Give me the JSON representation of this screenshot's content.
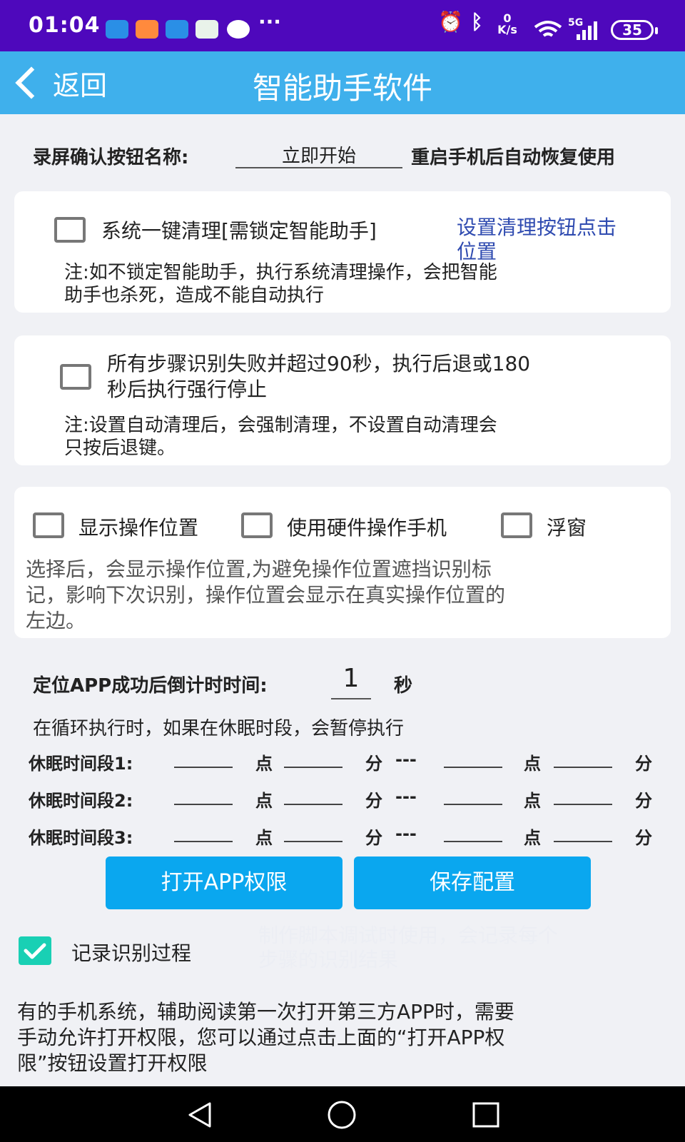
{
  "status_bar": {
    "time": "01:04",
    "more": "···",
    "net_speed_top": "0",
    "net_speed_bottom": "K/s",
    "signal_label": "5G",
    "battery": "35",
    "icons": [
      "app-icon",
      "app-icon",
      "app-icon",
      "reader-icon",
      "wechat-icon",
      "alarm-icon",
      "bluetooth-icon",
      "wifi-icon",
      "signal-icon",
      "battery-icon"
    ]
  },
  "header": {
    "back_label": "返回",
    "title": "智能助手软件"
  },
  "record": {
    "label": "录屏确认按钮名称:",
    "value": "立即开始",
    "note": "重启手机后自动恢复使用"
  },
  "card1": {
    "checkbox_label": "系统一键清理[需锁定智能助手]",
    "link_line1": "设置清理按钮点击",
    "link_line2": "位置",
    "note_line1": "注:如不锁定智能助手，执行系统清理操作，会把智能",
    "note_line2": "助手也杀死，造成不能自动执行"
  },
  "card2": {
    "checkbox_line1": "所有步骤识别失败并超过90秒，执行后退或180",
    "checkbox_line2": "秒后执行强行停止",
    "note_line1": "注:设置自动清理后，会强制清理，不设置自动清理会",
    "note_line2": "只按后退键。"
  },
  "card3": {
    "opt1": "显示操作位置",
    "opt2": "使用硬件操作手机",
    "opt3": "浮窗",
    "desc_line1": "选择后，会显示操作位置,为避免操作位置遮挡识别标",
    "desc_line2": "记，影响下次识别，操作位置会显示在真实操作位置的",
    "desc_line3": "左边。"
  },
  "countdown": {
    "label": "定位APP成功后倒计时时间:",
    "value": "1",
    "unit": "秒"
  },
  "sleep_intro": "在循环执行时，如果在休眠时段，会暂停执行",
  "sleep_rows": [
    {
      "label": "休眠时间段1:"
    },
    {
      "label": "休眠时间段2:"
    },
    {
      "label": "休眠时间段3:"
    }
  ],
  "sleep_units": {
    "hour": "点",
    "minute": "分",
    "sep": "---"
  },
  "buttons": {
    "open_permission": "打开APP权限",
    "save_config": "保存配置"
  },
  "record_process": {
    "label": "记录识别过程",
    "checked": true,
    "hint_line1": "制作脚本调试时使用，会记录每个",
    "hint_line2": "步骤的识别结果"
  },
  "footer_note": {
    "line1": "有的手机系统，辅助阅读第一次打开第三方APP时，需要",
    "line2": "手动允许打开权限，您可以通过点击上面的“打开APP权",
    "line3": "限”按钮设置打开权限"
  },
  "colors": {
    "status_bar": "#4e08bc",
    "title_bar": "#3fb0ec",
    "button": "#0aa7ef",
    "checkbox_checked": "#19d0b4",
    "link": "#2f4bb0"
  }
}
